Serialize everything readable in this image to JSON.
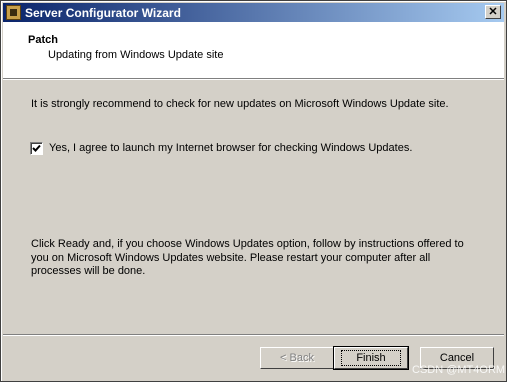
{
  "window": {
    "title": "Server Configurator Wizard",
    "close_symbol": "✕"
  },
  "header": {
    "title": "Patch",
    "subtitle": "Updating from Windows Update site"
  },
  "main": {
    "recommendation": "It is strongly recommend to check for new updates on Microsoft Windows Update site.",
    "agree_checkbox": {
      "checked": true,
      "label": "Yes, I agree to launch my Internet browser for checking Windows Updates."
    },
    "instructions": "Click Ready and, if you choose Windows Updates option, follow by instructions offered to you on Microsoft Windows Updates website. Please restart your computer after all processes will be done."
  },
  "footer": {
    "back_label": "< Back",
    "finish_label": "Finish",
    "cancel_label": "Cancel"
  },
  "watermark": "CSDN @MT4ORM"
}
